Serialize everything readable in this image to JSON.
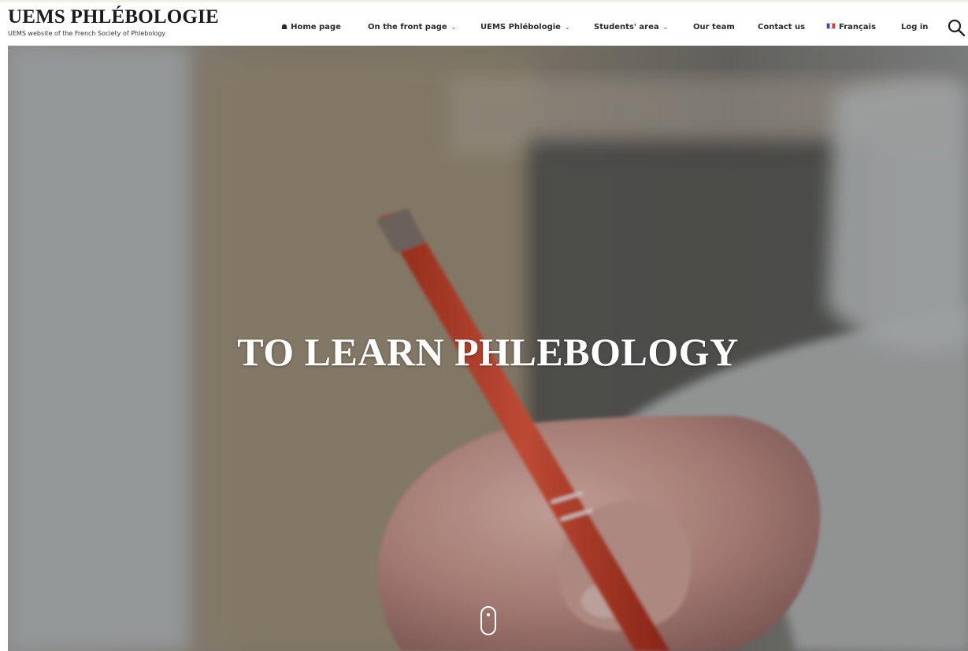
{
  "site": {
    "title": "UEMS PHLÉBOLOGIE",
    "tagline": "UEMS website of the French Society of Phlebology"
  },
  "nav": {
    "home": "Home page",
    "front_page": "On the front page",
    "uems": "UEMS Phlébologie",
    "students": "Students' area",
    "team": "Our team",
    "contact": "Contact us",
    "language": "Français",
    "login": "Log in",
    "home_glyph": "☗",
    "dropdown_glyph": "⌄"
  },
  "hero": {
    "title": "TO LEARN PHLEBOLOGY"
  },
  "colors": {
    "header_bg": "#ffffff",
    "nav_text": "#2a2a2a",
    "hero_text": "#ffffff"
  },
  "icons": {
    "search": "search-icon",
    "home": "home-icon",
    "flag": "french-flag-icon",
    "scroll": "scroll-down-mouse-icon"
  }
}
